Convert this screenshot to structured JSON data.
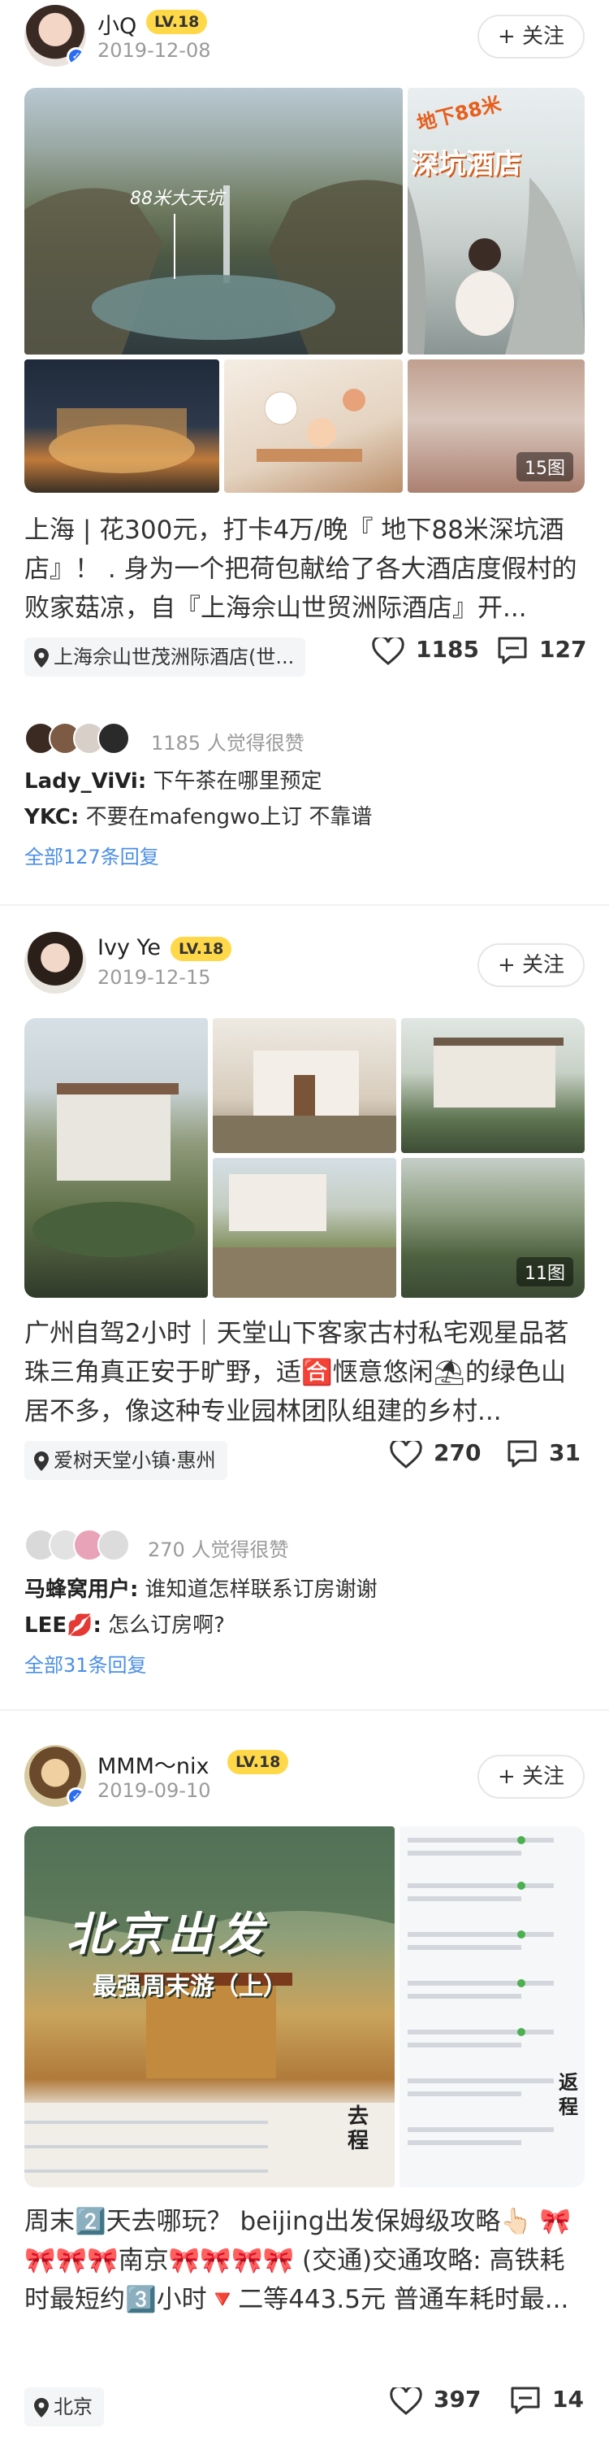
{
  "posts": [
    {
      "user": "小Q",
      "level": "LV.18",
      "date": "2019-12-08",
      "follow_label": "+ 关注",
      "image_texts": {
        "cliff_label": "88米大天坑",
        "hotel_line1": "地下88米",
        "hotel_line2": "深坑酒店",
        "count": "15图"
      },
      "body": "上海 | 花300元，打卡4万/晚『 地下88米深坑酒店』！ . 身为一个把荷包献给了各大酒店度假村的败家菇凉，自『上海佘山世贸洲际酒店』开...",
      "location": "上海佘山世茂洲际酒店(世...",
      "likes": "1185",
      "comments": "127",
      "likers_text": "1185 人觉得很赞",
      "replies": [
        {
          "user": "Lady_ViVi:",
          "text": "下午茶在哪里预定"
        },
        {
          "user": "YKC:",
          "text": "不要在mafengwo上订 不靠谱"
        }
      ],
      "all_replies": "全部127条回复"
    },
    {
      "user": "Ivy Ye",
      "level": "LV.18",
      "date": "2019-12-15",
      "follow_label": "+ 关注",
      "image_texts": {
        "count": "11图"
      },
      "body": "广州自驾2小时｜天堂山下客家古村私宅观星品茗 珠三角真正安于旷野，适🈴惬意悠闲⛱的绿色山居不多，像这种专业园林团队组建的乡村...",
      "location": "爱树天堂小镇·惠州",
      "likes": "270",
      "comments": "31",
      "likers_text": "270 人觉得很赞",
      "replies": [
        {
          "user": "马蜂窝用户:",
          "text": "谁知道怎样联系订房谢谢"
        },
        {
          "user": "LEE💋:",
          "text": "怎么订房啊?"
        }
      ],
      "all_replies": "全部31条回复"
    },
    {
      "user": "MMM～nix",
      "level": "LV.18",
      "date": "2019-09-10",
      "follow_label": "+ 关注",
      "image_texts": {
        "title": "北京出发",
        "subtitle": "最强周末游（上）",
        "side_a": "去程",
        "side_b": "返程"
      },
      "body": "周末2️⃣天去哪玩？ beijing出发保姆级攻略👆🏻 🎀🎀🎀🎀南京🎀🎀🎀🎀 (交通)交通攻略: 高铁耗时最短约3️⃣小时🔻二等443.5元 普通车耗时最...",
      "location": "北京",
      "likes": "397",
      "comments": "14"
    }
  ],
  "colors": {
    "level_badge": "#ffd84a",
    "link_blue": "#4a8ee8",
    "verified": "#2b6cf5"
  }
}
